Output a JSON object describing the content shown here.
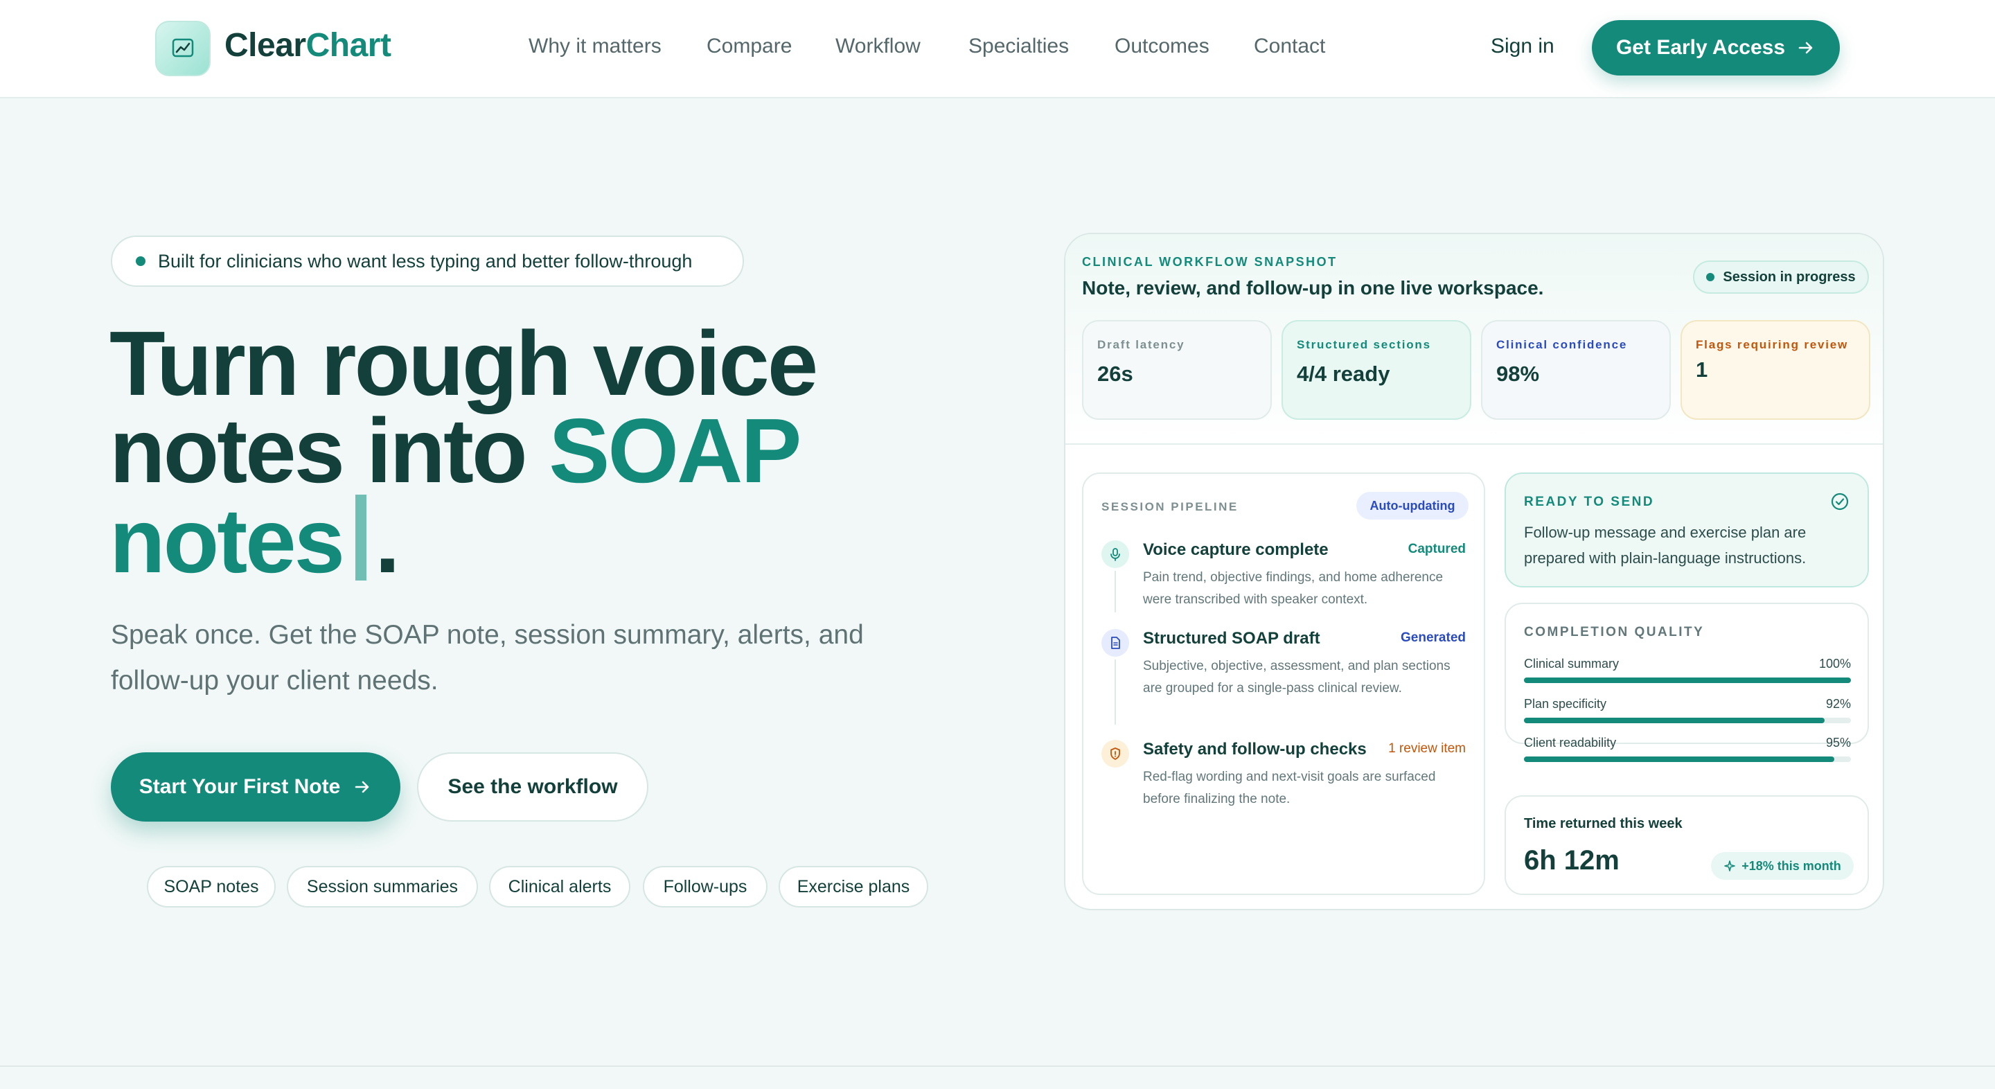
{
  "brand": {
    "name_part1": "Clear",
    "name_part2": "Chart",
    "logo_icon": "chart-logo-icon"
  },
  "nav": {
    "links": [
      "Why it matters",
      "Compare",
      "Workflow",
      "Specialties",
      "Outcomes",
      "Contact"
    ],
    "sign_in": "Sign in",
    "cta": "Get Early Access"
  },
  "hero": {
    "badge": "Built for clinicians who want less typing and better follow-through",
    "headline_line1": "Turn rough voice",
    "headline_line2_plain": "notes into ",
    "headline_line2_accent": "SOAP",
    "headline_line3_accent": "notes",
    "headline_line3_end": ".",
    "subtitle": "Speak once. Get the SOAP note, session summary, alerts, and follow-up your client needs.",
    "primary_button": "Start Your First Note",
    "secondary_button": "See the workflow",
    "chips": [
      "SOAP notes",
      "Session summaries",
      "Clinical alerts",
      "Follow-ups",
      "Exercise plans"
    ]
  },
  "snapshot": {
    "eyebrow": "Clinical workflow snapshot",
    "title": "Note, review, and follow-up in one live workspace.",
    "status": "Session in progress",
    "metrics": [
      {
        "label": "Draft latency",
        "value": "26s"
      },
      {
        "label": "Structured sections",
        "value": "4/4 ready"
      },
      {
        "label": "Clinical confidence",
        "value": "98%"
      },
      {
        "label": "Flags requiring review",
        "value": "1"
      }
    ],
    "pipeline": {
      "eyebrow": "Session pipeline",
      "badge": "Auto-updating",
      "steps": [
        {
          "icon": "microphone-icon",
          "title": "Voice capture complete",
          "status": "Captured",
          "desc": "Pain trend, objective findings, and home adherence were transcribed with speaker context."
        },
        {
          "icon": "document-icon",
          "title": "Structured SOAP draft",
          "status": "Generated",
          "desc": "Subjective, objective, assessment, and plan sections are grouped for a single-pass clinical review."
        },
        {
          "icon": "shield-alert-icon",
          "title": "Safety and follow-up checks",
          "status": "1 review item",
          "desc": "Red-flag wording and next-visit goals are surfaced before finalizing the note."
        }
      ]
    },
    "ready": {
      "eyebrow": "Ready to send",
      "body": "Follow-up message and exercise plan are prepared with plain-language instructions."
    },
    "quality": {
      "eyebrow": "Completion quality",
      "rows": [
        {
          "label": "Clinical summary",
          "value": "100%",
          "fraction": 1.0
        },
        {
          "label": "Plan specificity",
          "value": "92%",
          "fraction": 0.92
        },
        {
          "label": "Client readability",
          "value": "95%",
          "fraction": 0.95
        }
      ]
    },
    "time": {
      "label": "Time returned this week",
      "value": "6h 12m",
      "trend": "+18% this month"
    }
  },
  "colors": {
    "primary": "#138a7a",
    "dark": "#13403a",
    "background": "#f1f8f7",
    "alert": "#c2560c",
    "info": "#2a4bbd"
  }
}
